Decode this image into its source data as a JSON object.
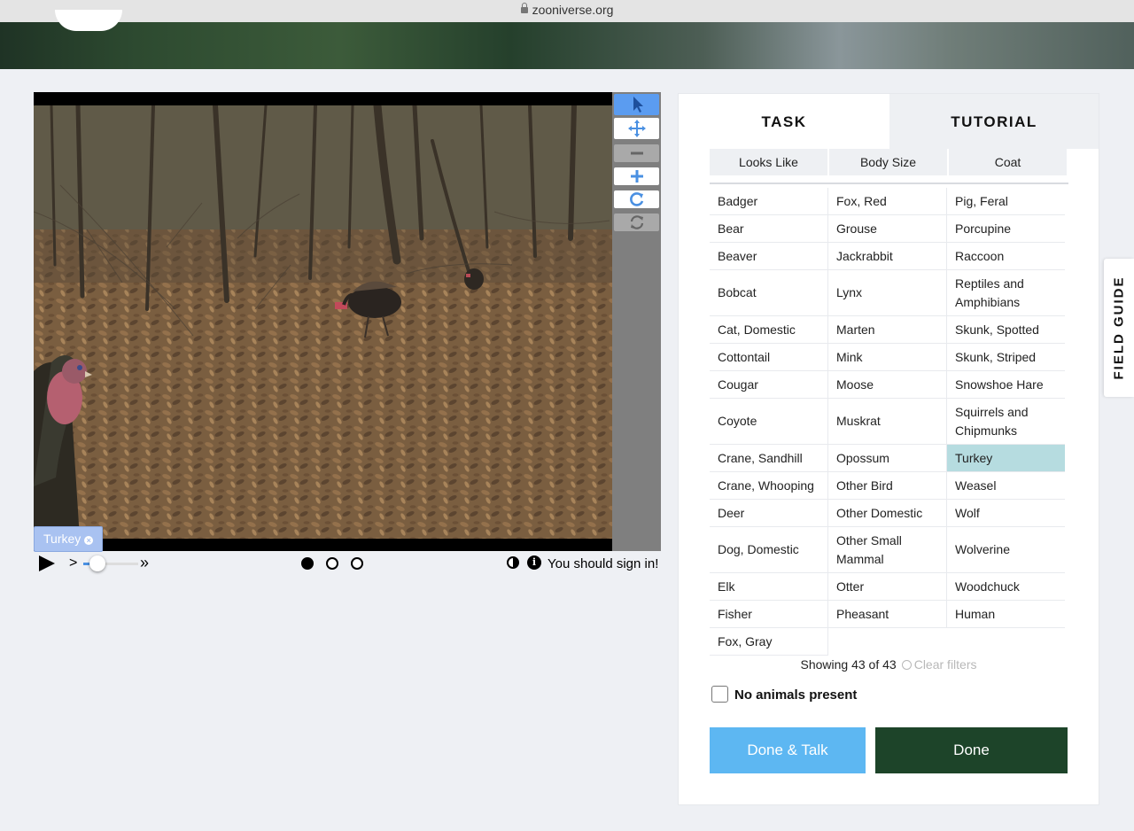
{
  "browser": {
    "url": "zooniverse.org"
  },
  "viewer": {
    "annotation_tag": "Turkey",
    "tag_close": "×",
    "sign_in_text": "You should sign in!",
    "info_glyph": "i",
    "slow_glyph": ">",
    "fast_glyph": "»",
    "frames": [
      "frame-1",
      "frame-2",
      "frame-3"
    ],
    "active_frame": 1,
    "playback_speed_fraction": 0.2
  },
  "task_panel": {
    "tabs": [
      "TASK",
      "TUTORIAL"
    ],
    "filters": [
      "Looks Like",
      "Body Size",
      "Coat"
    ],
    "choices": [
      [
        "Badger",
        "Fox, Red",
        "Pig, Feral"
      ],
      [
        "Bear",
        "Grouse",
        "Porcupine"
      ],
      [
        "Beaver",
        "Jackrabbit",
        "Raccoon"
      ],
      [
        "Bobcat",
        "Lynx",
        "Reptiles and Amphibians"
      ],
      [
        "Cat, Domestic",
        "Marten",
        "Skunk, Spotted"
      ],
      [
        "Cottontail",
        "Mink",
        "Skunk, Striped"
      ],
      [
        "Cougar",
        "Moose",
        "Snowshoe Hare"
      ],
      [
        "Coyote",
        "Muskrat",
        "Squirrels and Chipmunks"
      ],
      [
        "Crane, Sandhill",
        "Opossum",
        "Turkey"
      ],
      [
        "Crane, Whooping",
        "Other Bird",
        "Weasel"
      ],
      [
        "Deer",
        "Other Domestic",
        "Wolf"
      ],
      [
        "Dog, Domestic",
        "Other Small Mammal",
        "Wolverine"
      ],
      [
        "Elk",
        "Otter",
        "Woodchuck"
      ],
      [
        "Fisher",
        "Pheasant",
        "Human"
      ],
      [
        "Fox, Gray",
        "",
        ""
      ]
    ],
    "selected_choice": "Turkey",
    "showing_text": "Showing 43 of 43",
    "clear_filters": "Clear filters",
    "no_animals_label": "No animals present",
    "done_talk_label": "Done & Talk",
    "done_label": "Done"
  },
  "field_guide_label": "FIELD GUIDE",
  "colors": {
    "selected_choice": "#b6dce0",
    "done_talk": "#5db7f2",
    "done": "#1d4429",
    "active_tool": "#5b9cf0"
  },
  "icons": [
    "pointer-icon",
    "move-icon",
    "zoom-out-icon",
    "zoom-in-icon",
    "rotate-icon",
    "reset-icon",
    "play-icon",
    "contrast-icon",
    "info-icon",
    "lock-icon",
    "clear-filters-icon"
  ]
}
